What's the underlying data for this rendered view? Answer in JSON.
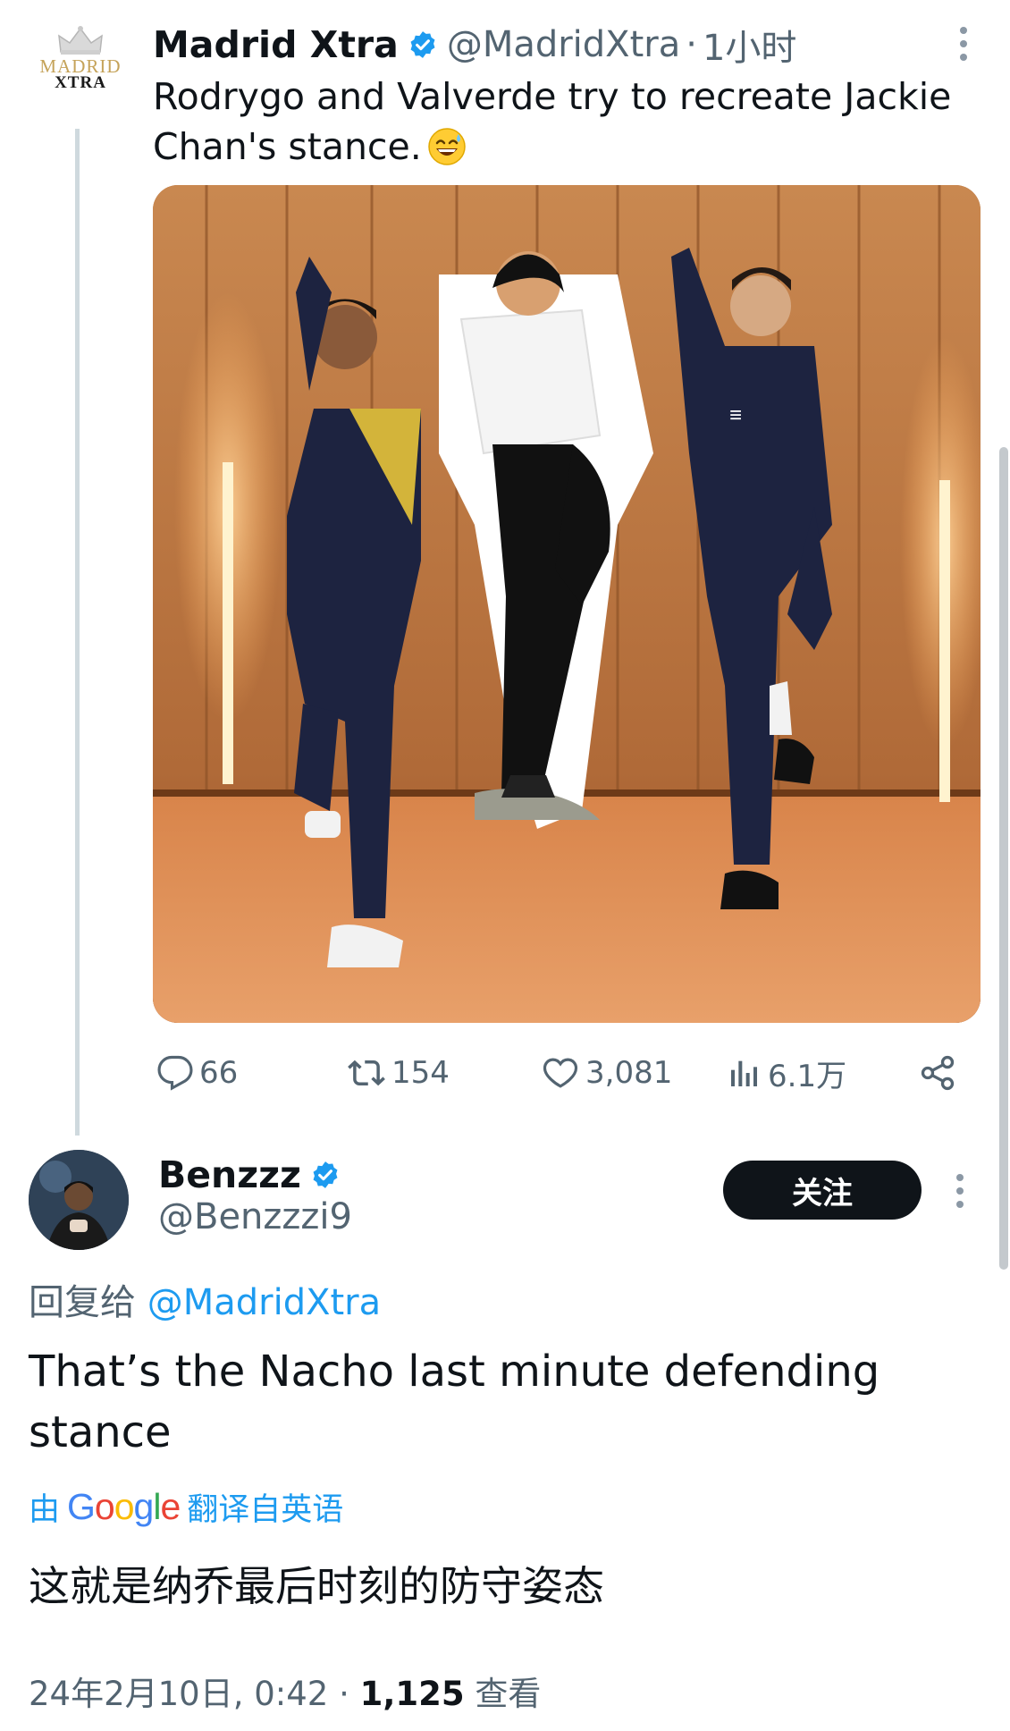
{
  "parent_tweet": {
    "avatar_text": [
      "MADRID",
      "XTRA"
    ],
    "author_name": "Madrid Xtra",
    "handle": "@MadridXtra",
    "time_sep": "·",
    "time": "1小时",
    "text": "Rodrygo and Valverde try to recreate Jackie Chan's stance.",
    "emoji": "grinning-sweat-emoji",
    "media_description_icon": "photo",
    "actions": {
      "replies": "66",
      "retweets": "154",
      "likes": "3,081",
      "views": "6.1万"
    }
  },
  "reply_tweet": {
    "author_name": "Benzzz",
    "handle": "@Benzzzi9",
    "follow_label": "关注",
    "reply_to_prefix": "回复给",
    "reply_to_handle": "@MadridXtra",
    "text": "That’s the Nacho last minute defending stance",
    "translate_prefix": "由",
    "translate_brand": "Google",
    "translate_suffix": "翻译自英语",
    "translated_text": "这就是纳乔最后时刻的防守姿态",
    "date": "24年2月10日, 0:42",
    "meta_sep": " · ",
    "view_count": "1,125",
    "view_label": "查看"
  },
  "colors": {
    "accent": "#1d9bf0",
    "secondary_text": "#536471",
    "primary_text": "#0f1419",
    "button_bg": "#0f1419"
  }
}
